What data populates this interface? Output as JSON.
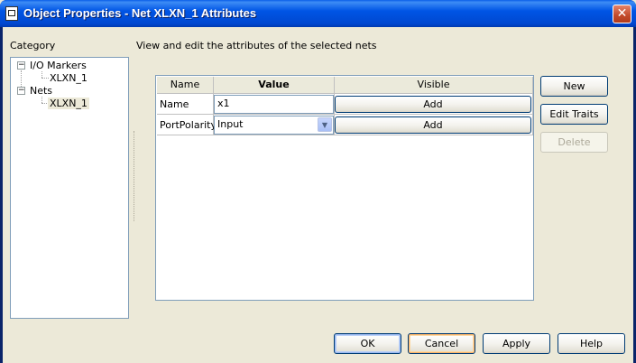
{
  "window": {
    "title": "Object Properties - Net XLXN_1 Attributes",
    "close_glyph": "✕"
  },
  "category": {
    "label": "Category",
    "tree": [
      {
        "label": "I/O Markers",
        "expander": "−",
        "children": [
          {
            "label": "XLXN_1",
            "selected": false
          }
        ]
      },
      {
        "label": "Nets",
        "expander": "−",
        "children": [
          {
            "label": "XLXN_1",
            "selected": true
          }
        ]
      }
    ]
  },
  "description": "View and edit the attributes of the selected nets",
  "table": {
    "headers": {
      "name": "Name",
      "value": "Value",
      "visible": "Visible"
    },
    "rows": [
      {
        "name": "Name",
        "value": "x1",
        "visible_button": "Add"
      },
      {
        "name": "PortPolarity",
        "value": "Input",
        "visible_button": "Add"
      }
    ],
    "combo_arrow_glyph": "▼"
  },
  "side_buttons": {
    "new": "New",
    "edit_traits": "Edit Traits",
    "delete": "Delete"
  },
  "footer_buttons": {
    "ok": "OK",
    "cancel": "Cancel",
    "apply": "Apply",
    "help": "Help"
  },
  "colors": {
    "title_bar": "#0055e5",
    "close_button": "#c24a2a",
    "panel": "#ece9d8",
    "border": "#7f9db9"
  },
  "icons": {
    "window": "document-icon",
    "close": "close-icon",
    "expander": "tree-collapse-icon",
    "dropdown": "chevron-down-icon"
  }
}
